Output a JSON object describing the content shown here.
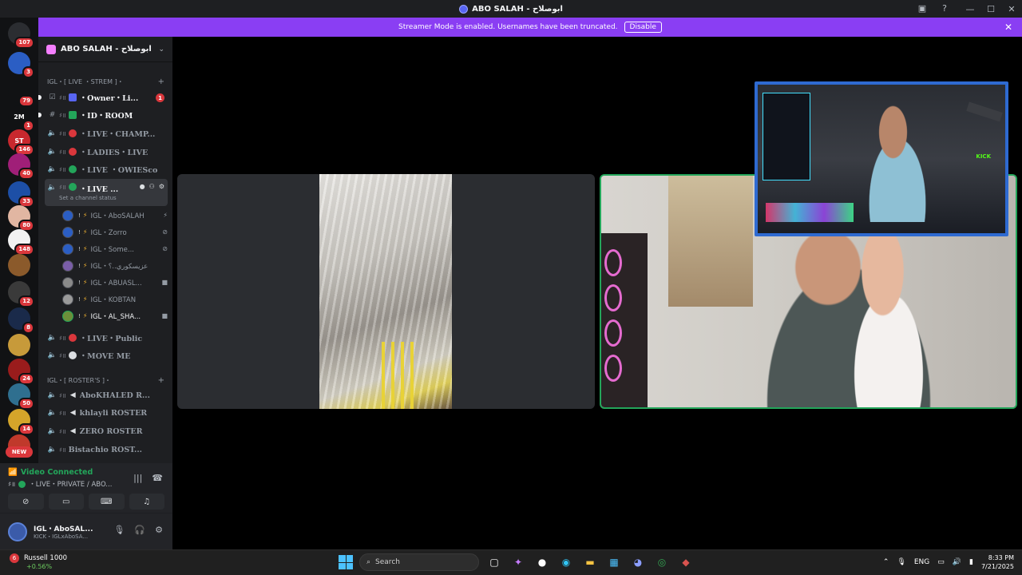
{
  "window": {
    "title": "ABO SALAH - ابوصلاح"
  },
  "banner": {
    "message": "Streamer Mode is enabled. Usernames have been truncated.",
    "disable_label": "Disable"
  },
  "rail": {
    "servers": [
      {
        "label": "",
        "badge": "107",
        "color": "#2b2d31"
      },
      {
        "label": "",
        "badge": "3",
        "color": "#2b5ec4"
      },
      {
        "label": "",
        "badge": "79",
        "color": "#111214"
      },
      {
        "label": "2M",
        "badge": "1",
        "color": "#111214"
      },
      {
        "label": "ST",
        "badge": "146",
        "color": "#c8282e"
      },
      {
        "label": "",
        "badge": "40",
        "color": "#a01f78"
      },
      {
        "label": "",
        "badge": "33",
        "color": "#1d4fa6"
      },
      {
        "label": "",
        "badge": "80",
        "color": "#e1b6a2"
      },
      {
        "label": "",
        "badge": "148",
        "color": "#f2f2f2"
      },
      {
        "label": "",
        "badge": "",
        "color": "#8b5a2b"
      },
      {
        "label": "",
        "badge": "12",
        "color": "#3a3a3a"
      },
      {
        "label": "",
        "badge": "8",
        "color": "#1a2a4a"
      },
      {
        "label": "",
        "badge": "",
        "color": "#c79a3a"
      },
      {
        "label": "",
        "badge": "24",
        "color": "#9a1c1c"
      },
      {
        "label": "",
        "badge": "50",
        "color": "#2f6f8f"
      },
      {
        "label": "",
        "badge": "14",
        "color": "#d4a52a"
      },
      {
        "label": "",
        "badge": "",
        "color": "#c0392b"
      }
    ],
    "new_label": "NEW"
  },
  "guild": {
    "name": "ABO SALAH - ابوصلاح"
  },
  "categories": [
    {
      "label": "IGL・[ LIVE ・STREM ]・"
    },
    {
      "label": "IGL・[ ROSTER'S ]・"
    }
  ],
  "channels": [
    {
      "label": "・Owner・Li...",
      "mention": "1"
    },
    {
      "label": "・ID・ROOM"
    },
    {
      "label": "・LIVE・CHAMP..."
    },
    {
      "label": "・LADIES・LIVE"
    },
    {
      "label": "・LIVE ・OWIESco"
    },
    {
      "label": "・LIVE ...",
      "status": "Set a channel status"
    },
    {
      "label": "・LIVE・Public"
    },
    {
      "label": "・MOVE ME"
    },
    {
      "label": "AboKHALED R..."
    },
    {
      "label": "khlayli ROSTER"
    },
    {
      "label": "ZERO ROSTER"
    },
    {
      "label": "Bistachio ROST..."
    }
  ],
  "members": [
    {
      "tag": "!",
      "name": "IGL・AboSALAH"
    },
    {
      "tag": "!",
      "name": "IGL・Zorro"
    },
    {
      "tag": "!",
      "name": "IGL・Some..."
    },
    {
      "tag": "!",
      "name": "IGL・عزيسكوري..؟"
    },
    {
      "tag": "!",
      "name": "IGL・ABUASL..."
    },
    {
      "tag": "!",
      "name": "IGL・KOBTAN"
    },
    {
      "tag": "!",
      "name": "IGL・AL_SHA..."
    }
  ],
  "voice": {
    "status": "Video Connected",
    "channel": "・LIVE・PRIVATE / ABO..."
  },
  "user": {
    "name": "IGL・AboSAL...",
    "status": "KICK・IGLxAboSA..."
  },
  "overlay": {
    "kick_label": "KICK"
  },
  "taskbar": {
    "stock_badge": "6",
    "stock_name": "Russell 1000",
    "stock_change": "+0.56%",
    "search_placeholder": "Search",
    "discord_badge": "99",
    "lang": "ENG",
    "time": "8:33 PM",
    "date": "7/21/2025"
  }
}
